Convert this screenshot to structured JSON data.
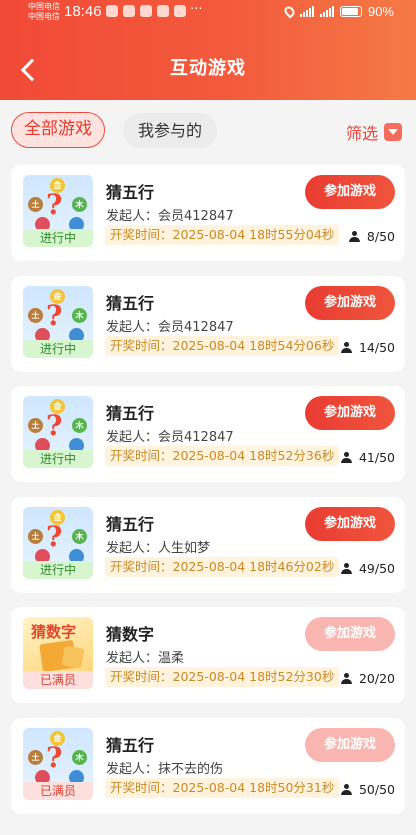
{
  "status_bar": {
    "carrier_1": "中国电信",
    "carrier_2": "中国电信",
    "time": "18:46",
    "more": "···",
    "battery": "90%"
  },
  "header": {
    "title": "互动游戏"
  },
  "tabs": {
    "all": "全部游戏",
    "mine": "我参与的",
    "filter": "筛选"
  },
  "join_label": "参加游戏",
  "games": [
    {
      "name": "猜五行",
      "initiator": "发起人：会员412847",
      "draw_time": "开奖时间：2025-08-04 18时55分04秒",
      "status": "进行中",
      "participants": "8/50",
      "type": "wuxing",
      "full": false
    },
    {
      "name": "猜五行",
      "initiator": "发起人：会员412847",
      "draw_time": "开奖时间：2025-08-04 18时54分06秒",
      "status": "进行中",
      "participants": "14/50",
      "type": "wuxing",
      "full": false
    },
    {
      "name": "猜五行",
      "initiator": "发起人：会员412847",
      "draw_time": "开奖时间：2025-08-04 18时52分36秒",
      "status": "进行中",
      "participants": "41/50",
      "type": "wuxing",
      "full": false
    },
    {
      "name": "猜五行",
      "initiator": "发起人：人生如梦",
      "draw_time": "开奖时间：2025-08-04 18时46分02秒",
      "status": "进行中",
      "participants": "49/50",
      "type": "wuxing",
      "full": false
    },
    {
      "name": "猜数字",
      "initiator": "发起人：温柔",
      "draw_time": "开奖时间：2025-08-04 18时52分30秒",
      "status": "已满员",
      "participants": "20/20",
      "type": "number",
      "full": true
    },
    {
      "name": "猜五行",
      "initiator": "发起人：抹不去的伤",
      "draw_time": "开奖时间：2025-08-04 18时50分31秒",
      "status": "已满员",
      "participants": "50/50",
      "type": "wuxing",
      "full": true
    }
  ],
  "thumb_text": {
    "wuxing_gold": "金",
    "wuxing_earth": "土",
    "wuxing_wood": "木",
    "wuxing_q": "?",
    "number_title": "猜数字"
  }
}
